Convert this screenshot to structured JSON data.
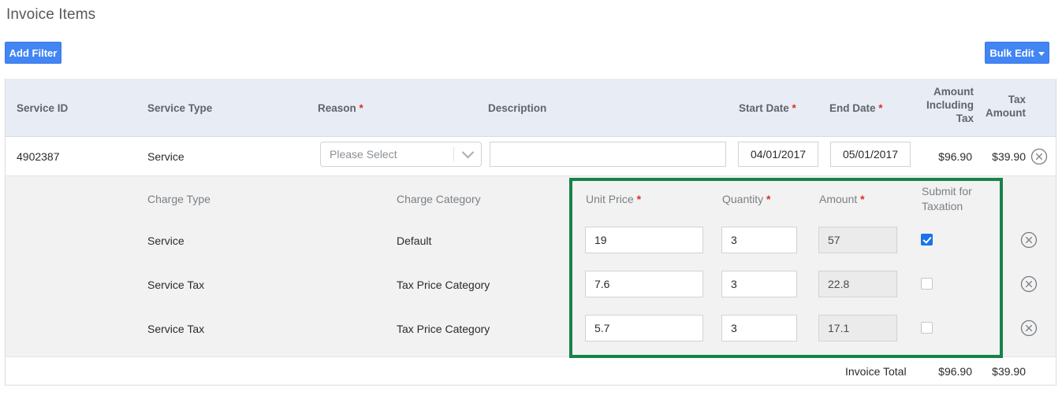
{
  "page": {
    "title": "Invoice Items"
  },
  "toolbar": {
    "add_filter_label": "Add Filter",
    "bulk_edit_label": "Bulk Edit"
  },
  "colors": {
    "primary_button": "#4285f4",
    "header_background": "#e8edf5",
    "highlight_border": "#17824b",
    "required_asterisk": "#d93025",
    "checkbox_checked": "#1a73e8"
  },
  "table": {
    "columns": [
      {
        "label": "Service ID",
        "required": false
      },
      {
        "label": "Service Type",
        "required": false
      },
      {
        "label": "Reason",
        "required": true
      },
      {
        "label": "Description",
        "required": false
      },
      {
        "label": "Start Date",
        "required": true
      },
      {
        "label": "End Date",
        "required": true
      },
      {
        "label": "Amount Including Tax",
        "required": false
      },
      {
        "label": "Tax Amount",
        "required": false
      }
    ],
    "rows": [
      {
        "service_id": "4902387",
        "service_type": "Service",
        "reason_placeholder": "Please Select",
        "reason_value": "",
        "description_value": "",
        "start_date": "04/01/2017",
        "end_date": "05/01/2017",
        "amount_including_tax": "$96.90",
        "tax_amount": "$39.90",
        "remove_icon": "circle-x-icon"
      }
    ]
  },
  "subtable": {
    "columns": [
      {
        "label": "Charge Type",
        "required": false
      },
      {
        "label": "Charge Category",
        "required": false
      },
      {
        "label": "Unit Price",
        "required": true
      },
      {
        "label": "Quantity",
        "required": true
      },
      {
        "label": "Amount",
        "required": true
      },
      {
        "label": "Submit for Taxation",
        "required": false
      }
    ],
    "rows": [
      {
        "charge_type": "Service",
        "charge_category": "Default",
        "unit_price": "19",
        "quantity": "3",
        "amount": "57",
        "submit_for_taxation": true,
        "remove_icon": "circle-x-icon"
      },
      {
        "charge_type": "Service Tax",
        "charge_category": "Tax Price Category",
        "unit_price": "7.6",
        "quantity": "3",
        "amount": "22.8",
        "submit_for_taxation": false,
        "remove_icon": "circle-x-icon"
      },
      {
        "charge_type": "Service Tax",
        "charge_category": "Tax Price Category",
        "unit_price": "5.7",
        "quantity": "3",
        "amount": "17.1",
        "submit_for_taxation": false,
        "remove_icon": "circle-x-icon"
      }
    ]
  },
  "footer": {
    "label": "Invoice Total",
    "amount_including_tax": "$96.90",
    "tax_amount": "$39.90"
  }
}
